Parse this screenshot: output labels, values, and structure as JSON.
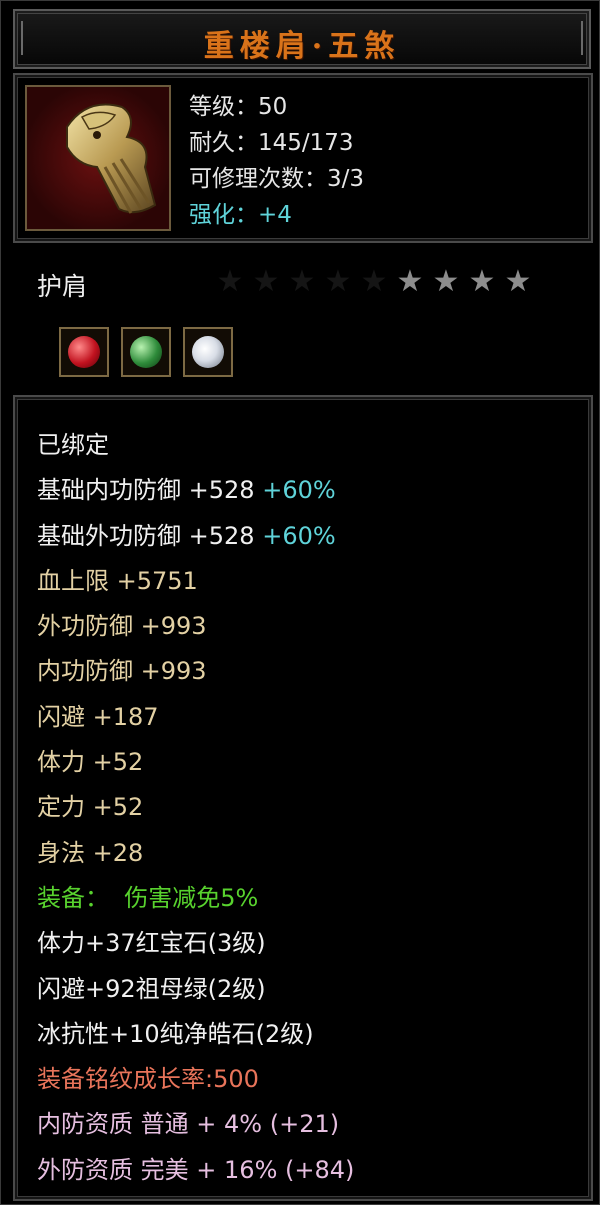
{
  "item": {
    "name": "重楼肩·五煞",
    "level": "等级：50",
    "durability": "耐久：145/173",
    "repairs": "可修理次数：3/3",
    "enhance_label": "强化：",
    "enhance_value": "+4",
    "category": "护肩",
    "stars": {
      "total": 9,
      "lit": 4
    },
    "gems": [
      {
        "icon": "ruby-gem-icon",
        "color": "#c1121f"
      },
      {
        "icon": "emerald-gem-icon",
        "color": "#2e8b3a"
      },
      {
        "icon": "diamond-gem-icon",
        "color": "#d8dde6"
      }
    ]
  },
  "attributes": {
    "bound": "已绑定",
    "base_inner": {
      "label": "基础内功防御",
      "value": "+528",
      "bonus": "+60%"
    },
    "base_outer": {
      "label": "基础外功防御",
      "value": "+528",
      "bonus": "+60%"
    },
    "hp": {
      "label": "血上限",
      "value": "+5751"
    },
    "outer_def": {
      "label": "外功防御",
      "value": "+993"
    },
    "inner_def": {
      "label": "内功防御",
      "value": "+993"
    },
    "dodge": {
      "label": "闪避",
      "value": "+187"
    },
    "stamina": {
      "label": "体力",
      "value": "+52"
    },
    "focus": {
      "label": "定力",
      "value": "+52"
    },
    "agility": {
      "label": "身法",
      "value": "+28"
    },
    "equip_label": "装备：",
    "equip_value": "伤害减免5%",
    "gem_lines": [
      "体力+37红宝石(3级)",
      "闪避+92祖母绿(2级)",
      "冰抗性+10纯净皓石(2级)"
    ],
    "inscription": "装备铭纹成长率:500",
    "inner_quality": {
      "label": "内防资质",
      "grade": "普通",
      "plus": "+",
      "pct": "4%",
      "extra": "(+21)"
    },
    "outer_quality": {
      "label": "外防资质",
      "grade": "完美",
      "plus": "+",
      "pct": "16%",
      "extra": "(+84)"
    }
  },
  "colors": {
    "title": "#d9731a",
    "cyan": "#5fd3d9",
    "tan": "#e3d1a4",
    "green": "#58d22e",
    "orange": "#e8745a",
    "pink": "#e6bfe0"
  }
}
